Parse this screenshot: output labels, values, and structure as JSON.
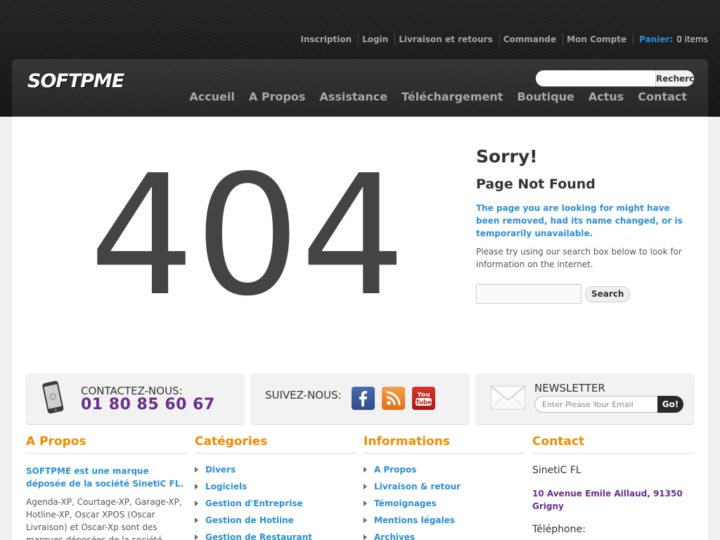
{
  "top_links": {
    "inscription": "Inscription",
    "login": "Login",
    "livraison": "Livraison et retours",
    "commande": "Commande",
    "compte": "Mon Compte",
    "cart_label": "Panier:",
    "cart_count": "0 items"
  },
  "header": {
    "logo": "SOFTPME",
    "search_button": "Recherche",
    "search_value": ""
  },
  "nav": [
    "Accueil",
    "A Propos",
    "Assistance",
    "Téléchargement",
    "Boutique",
    "Actus",
    "Contact"
  ],
  "error": {
    "code": "404",
    "title": "Sorry!",
    "subtitle": "Page Not Found",
    "message": "The page you are looking for might have been removed, had its name changed, or is temporarily unavailable.",
    "hint": "Please try using our search box below to look for information on the internet.",
    "search_button": "Search",
    "search_value": ""
  },
  "strip": {
    "contact_label": "CONTACTEZ-NOUS:",
    "contact_phone": "01 80 85 60 67",
    "follow_label": "SUIVEZ-NOUS:",
    "newsletter_label": "NEWSLETTER",
    "newsletter_placeholder": "Enter Please Your Email",
    "newsletter_button": "Go!"
  },
  "footer": {
    "about": {
      "heading": "A Propos",
      "bold": "SOFTPME est une marque déposée de la société SinetiC FL.",
      "text": "Agenda-XP, Courtage-XP, Garage-XP, Hotline-XP, Oscar XPOS (Oscar Livraison) et Oscar-Xp sont des marques déposées de la société"
    },
    "categories": {
      "heading": "Catégories",
      "items": [
        "Divers",
        "Logiciels",
        "Gestion d'Entreprise",
        "Gestion de Hotline",
        "Gestion de Restaurant"
      ]
    },
    "informations": {
      "heading": "Informations",
      "items": [
        "A Propos",
        "Livraison & retour",
        "Témoignages",
        "Mentions légales",
        "Archives"
      ]
    },
    "contact": {
      "heading": "Contact",
      "name": "SinetiC FL",
      "address": "10 Avenue Emile Aillaud, 91350 Grigny",
      "phone_label": "Téléphone:"
    }
  },
  "colors": {
    "link_blue": "#2b8fd6",
    "accent_orange": "#f08c00",
    "purple": "#6a2d8e"
  }
}
